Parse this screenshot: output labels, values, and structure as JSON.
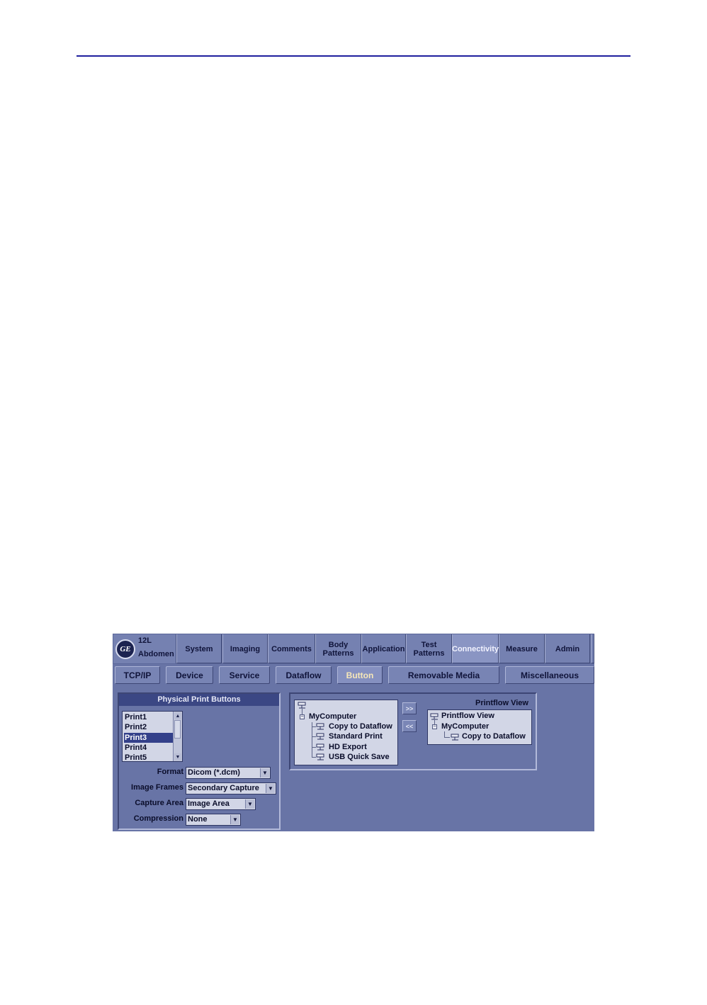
{
  "header": {
    "rule_color": "#1f1f9e"
  },
  "status": {
    "probe": "12L",
    "application": "Abdomen"
  },
  "top_tabs": [
    {
      "label_lines": [
        "System"
      ],
      "active": false
    },
    {
      "label_lines": [
        "Imaging"
      ],
      "active": false
    },
    {
      "label_lines": [
        "Comments"
      ],
      "active": false
    },
    {
      "label_lines": [
        "Body",
        "Patterns"
      ],
      "active": false
    },
    {
      "label_lines": [
        "Application"
      ],
      "active": false
    },
    {
      "label_lines": [
        "Test",
        "Patterns"
      ],
      "active": false
    },
    {
      "label_lines": [
        "Connectivity"
      ],
      "active": true
    },
    {
      "label_lines": [
        "Measure"
      ],
      "active": false
    },
    {
      "label_lines": [
        "Admin"
      ],
      "active": false
    }
  ],
  "sub_tabs": [
    {
      "label": "TCP/IP",
      "active": false
    },
    {
      "label": "Device",
      "active": false
    },
    {
      "label": "Service",
      "active": false
    },
    {
      "label": "Dataflow",
      "active": false
    },
    {
      "label": "Button",
      "active": true
    },
    {
      "label": "Removable Media",
      "active": false
    },
    {
      "label": "Miscellaneous",
      "active": false
    }
  ],
  "print_buttons": {
    "title": "Physical Print Buttons",
    "items": [
      "Print1",
      "Print2",
      "Print3",
      "Print4",
      "Print5"
    ],
    "selected": "Print3",
    "fields": [
      {
        "label": "Format",
        "value": "Dicom (*.dcm)"
      },
      {
        "label": "Image Frames",
        "value": "Secondary Capture"
      },
      {
        "label": "Capture Area",
        "value": "Image Area"
      },
      {
        "label": "Compression",
        "value": "None"
      }
    ]
  },
  "source_tree": {
    "root": "MyComputer",
    "children": [
      "Copy to Dataflow",
      "Standard Print",
      "HD Export",
      "USB Quick Save"
    ]
  },
  "move_buttons": {
    "add": ">>",
    "remove": "<<"
  },
  "printflow": {
    "title": "Printflow View",
    "root": "Printflow View",
    "computer": "MyComputer",
    "child": "Copy to Dataflow"
  },
  "icons": {
    "logo": "ge-logo",
    "node": "network-node-icon",
    "expander": "collapse-minus-icon",
    "scroll_up": "scroll-up-arrow-icon",
    "scroll_down": "scroll-down-arrow-icon",
    "dropdown": "dropdown-arrow-icon"
  },
  "logo_text": "GE"
}
